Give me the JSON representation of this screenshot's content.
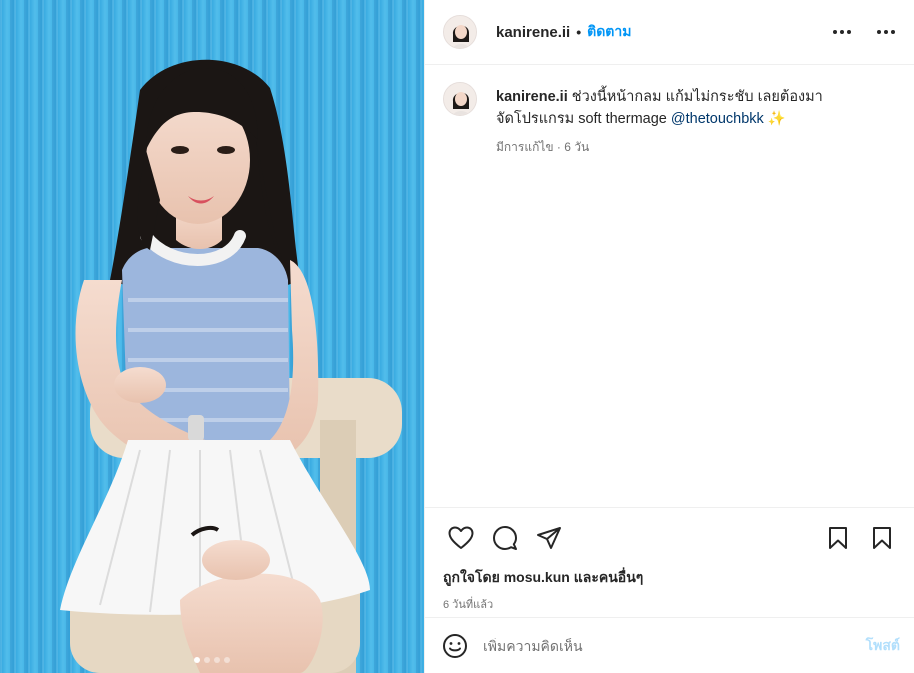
{
  "header": {
    "username": "kanirene.ii",
    "separator": "•",
    "follow_label": "ติดตาม"
  },
  "caption": {
    "username": "kanirene.ii",
    "text_before": " ช่วงนี้หน้ากลม แก้มไม่กระชับ เลยต้องมาจัดโปรแกรม soft thermage ",
    "mention": "@thetouchbkk",
    "emoji": " ✨",
    "meta": "มีการแก้ไข · 6 วัน"
  },
  "likes": {
    "prefix": "ถูกใจโดย ",
    "liker": "mosu.kun",
    "middle": " และ",
    "others": "คนอื่นๆ",
    "time_ago": "6 วันที่แล้ว"
  },
  "comment_box": {
    "placeholder": "เพิ่มความคิดเห็น",
    "post_label": "โพสต์"
  },
  "carousel": {
    "total": 4,
    "active_index": 0
  },
  "colors": {
    "accent": "#0095f6",
    "background_blue": "#3fb0e6",
    "post_disabled": "#b2dffc"
  },
  "icons": {
    "header_more": "more-horizontal-icon",
    "like": "heart-icon",
    "comment": "comment-bubble-icon",
    "share": "paper-plane-icon",
    "save": "bookmark-icon",
    "emoji": "smiley-icon"
  }
}
